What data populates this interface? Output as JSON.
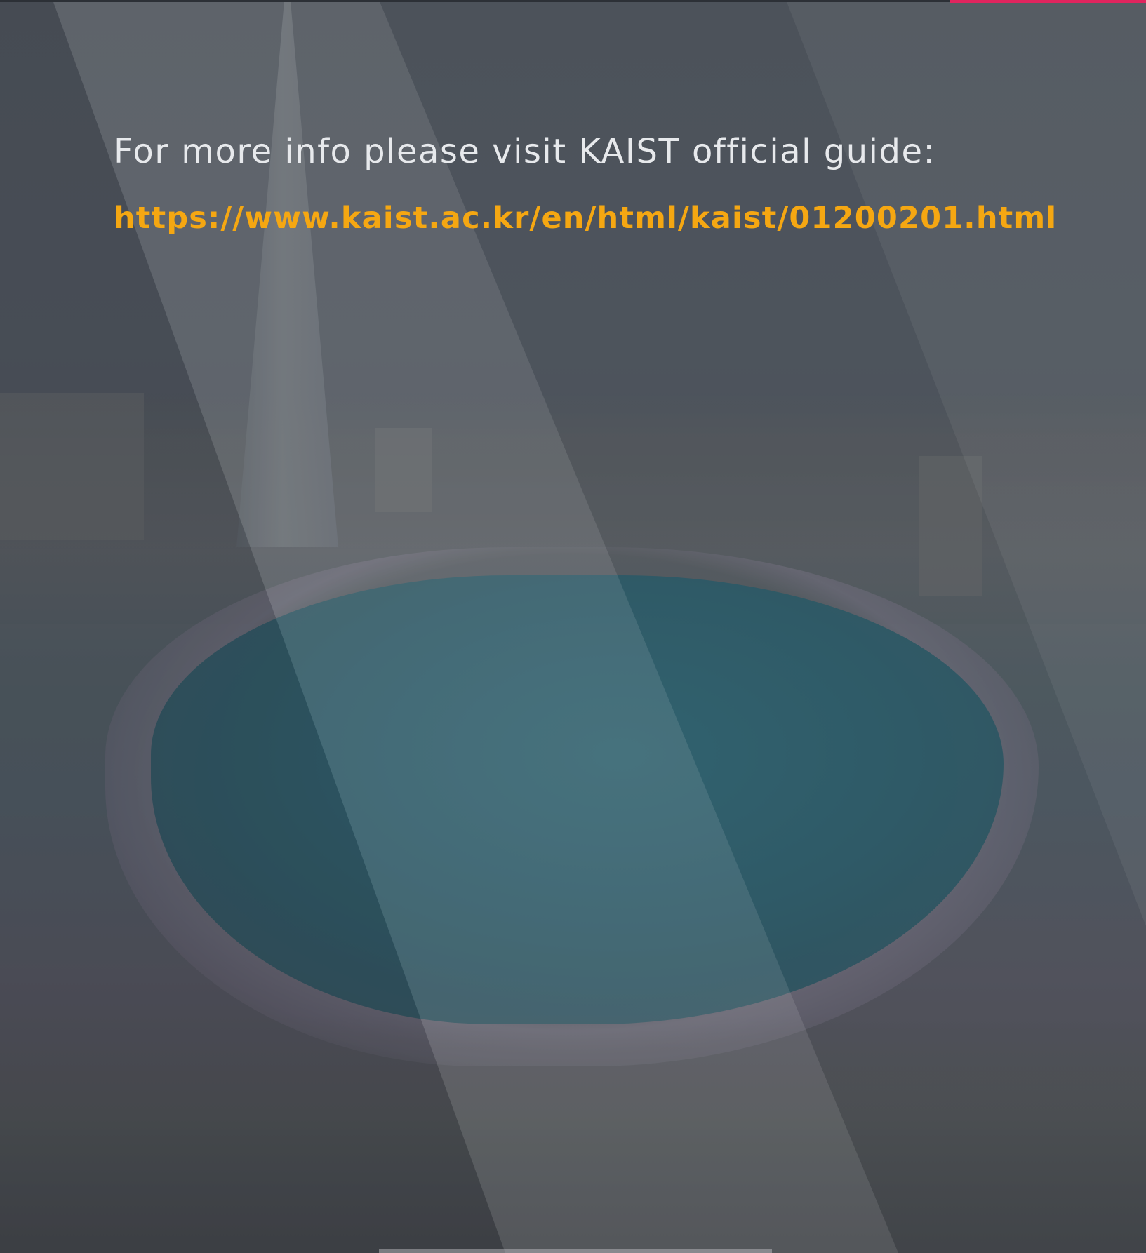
{
  "info": {
    "text": "For more info please visit KAIST official guide:"
  },
  "link": {
    "url_text": "https://www.kaist.ac.kr/en/html/kaist/01200201.html"
  },
  "colors": {
    "accent": "#e0245e",
    "link": "#f5a712",
    "text": "#e7e9ec"
  }
}
